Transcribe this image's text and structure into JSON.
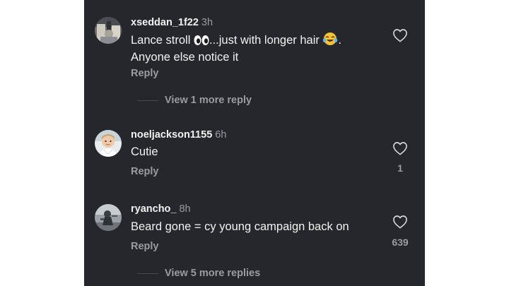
{
  "comments": [
    {
      "username": "xseddan_1f22",
      "time": "3h",
      "text_part1": "Lance stroll ",
      "emoji1": "eyes-emoji",
      "text_part2": "...just with longer hair ",
      "emoji2": "laughing-emoji",
      "text_part3": ".",
      "text_line2": "Anyone else notice it",
      "reply_label": "Reply",
      "likes": "",
      "view_replies": "View 1 more reply"
    },
    {
      "username": "noeljackson1155",
      "time": "6h",
      "text": "Cutie",
      "reply_label": "Reply",
      "likes": "1"
    },
    {
      "username": "ryancho_",
      "time": "8h",
      "text": "Beard gone = cy young campaign back on",
      "reply_label": "Reply",
      "likes": "639",
      "view_replies": "View 5 more replies"
    }
  ],
  "icons": {
    "like": "heart-outline-icon"
  },
  "colors": {
    "background": "#25272c",
    "primary_text": "#f2f2f2",
    "secondary_text": "#9a9ca2"
  }
}
